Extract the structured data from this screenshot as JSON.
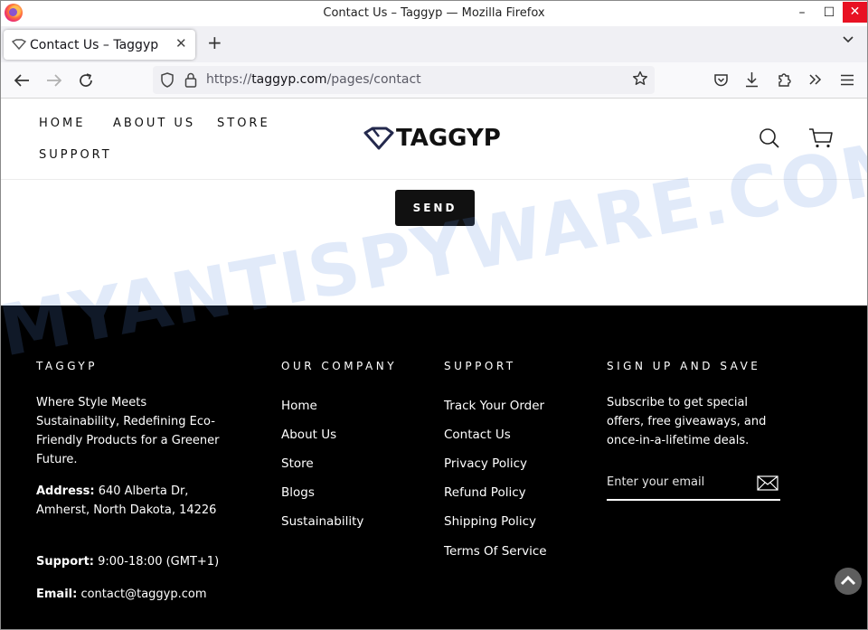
{
  "window": {
    "title": "Contact Us – Taggyp — Mozilla Firefox",
    "minimize_glyph": "–",
    "maximize_glyph": "☐",
    "close_glyph": "✕"
  },
  "tabs": [
    {
      "label": "Contact Us – Taggyp",
      "active": true
    }
  ],
  "tab_controls": {
    "new_tab": "+",
    "list_all": "⌄"
  },
  "navbar": {
    "url_scheme": "https://",
    "url_domain": "taggyp.com",
    "url_path": "/pages/contact"
  },
  "site": {
    "nav": [
      "HOME",
      "ABOUT US",
      "STORE",
      "SUPPORT"
    ],
    "logo_text": "TAGGYP",
    "send_label": "SEND"
  },
  "footer": {
    "col1": {
      "heading": "TAGGYP",
      "tagline": "Where Style Meets Sustainability, Redefining Eco-Friendly Products for a Greener Future.",
      "address_label": "Address:",
      "address_value": " 640 Alberta Dr, Amherst, North Dakota, 14226",
      "support_label": "Support:",
      "support_value": " 9:00-18:00 (GMT+1)",
      "email_label": "Email:",
      "email_value": " contact@taggyp.com"
    },
    "col2": {
      "heading": "OUR COMPANY",
      "links": [
        "Home",
        "About Us",
        "Store",
        "Blogs",
        "Sustainability"
      ]
    },
    "col3": {
      "heading": "SUPPORT",
      "links": [
        "Track Your Order",
        "Contact Us",
        "Privacy Policy",
        "Refund Policy",
        "Shipping Policy",
        "Terms Of Service"
      ]
    },
    "col4": {
      "heading": "SIGN UP AND SAVE",
      "text": "Subscribe to get special offers, free giveaways, and once-in-a-lifetime deals.",
      "email_placeholder": "Enter your email"
    }
  },
  "watermark": "MYANTISPYWARE.COM",
  "colors": {
    "footer_bg": "#000000",
    "close_button": "#e81123",
    "send_button": "#111111"
  }
}
